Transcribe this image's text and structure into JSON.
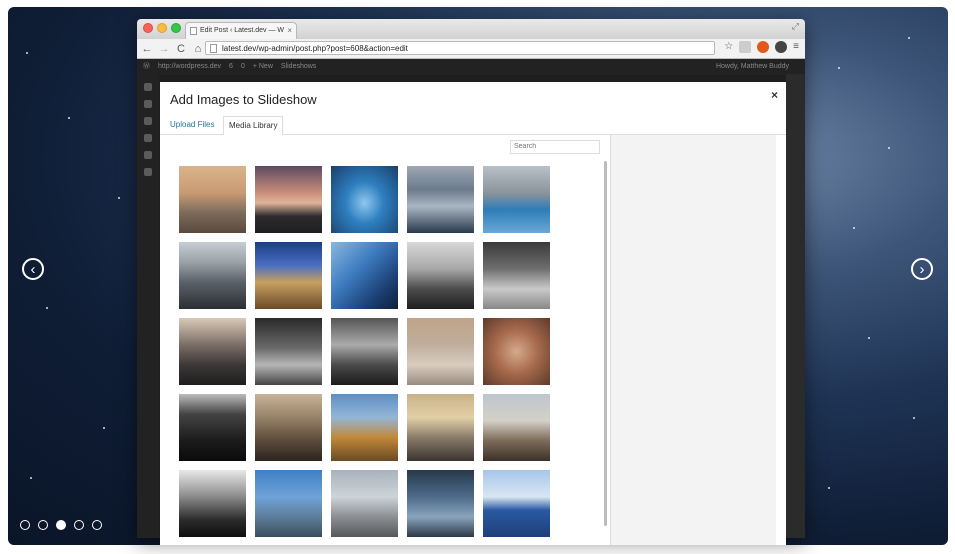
{
  "slider": {
    "prev_icon": "‹",
    "next_icon": "›",
    "dots": [
      false,
      false,
      true,
      false,
      false
    ]
  },
  "browser": {
    "tab_title": "Edit Post ‹ Latest.dev — W",
    "tab_close": "×",
    "url": "latest.dev/wp-admin/post.php?post=608&action=edit",
    "nav": {
      "back": "←",
      "forward": "→",
      "reload": "C",
      "home": "⌂"
    },
    "menu_icon": "≡",
    "star_icon": "☆"
  },
  "wp_admin_bar": {
    "site": "http://wordpress.dev",
    "updates": "6",
    "comments": "0",
    "new": "+ New",
    "slideshows": "Slideshows",
    "howdy": "Howdy, Matthew Buddy"
  },
  "modal": {
    "title": "Add Images to Slideshow",
    "close": "×",
    "tabs": {
      "upload": "Upload Files",
      "library": "Media Library"
    },
    "search_placeholder": "Search"
  },
  "colors": {
    "link": "#21759b",
    "wp_admin_bar": "#222222",
    "modal_bg": "#ffffff",
    "details_bg": "#f3f3f3"
  },
  "icons": [
    "chevron-left-icon",
    "chevron-right-icon",
    "close-icon",
    "star-icon",
    "menu-icon",
    "home-icon",
    "reload-icon"
  ]
}
